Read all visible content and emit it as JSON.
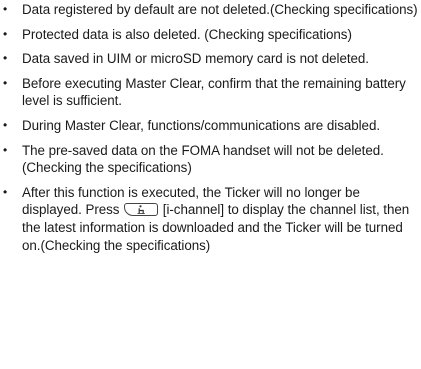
{
  "notes": [
    {
      "text": "Data registered by default are not deleted.(Checking specifications)"
    },
    {
      "text": "Protected data is also deleted. (Checking specifications)"
    },
    {
      "text": "Data saved in UIM or microSD memory card is not deleted."
    },
    {
      "text": "Before executing Master Clear, confirm that the remaining battery level is sufficient."
    },
    {
      "text": "During Master Clear, functions/communications are disabled."
    },
    {
      "text": "The pre-saved data on the FOMA handset will not be deleted.(Checking the specifications)"
    },
    {
      "text_before_icon": "After this function is executed, the Ticker will no longer be displayed. Press",
      "icon": "i-channel-key-icon",
      "text_after_icon": " [i-channel] to display the channel list, then the latest information is downloaded and the Ticker will be turned on.(Checking the specifications)"
    }
  ],
  "bullet_symbol": "•"
}
